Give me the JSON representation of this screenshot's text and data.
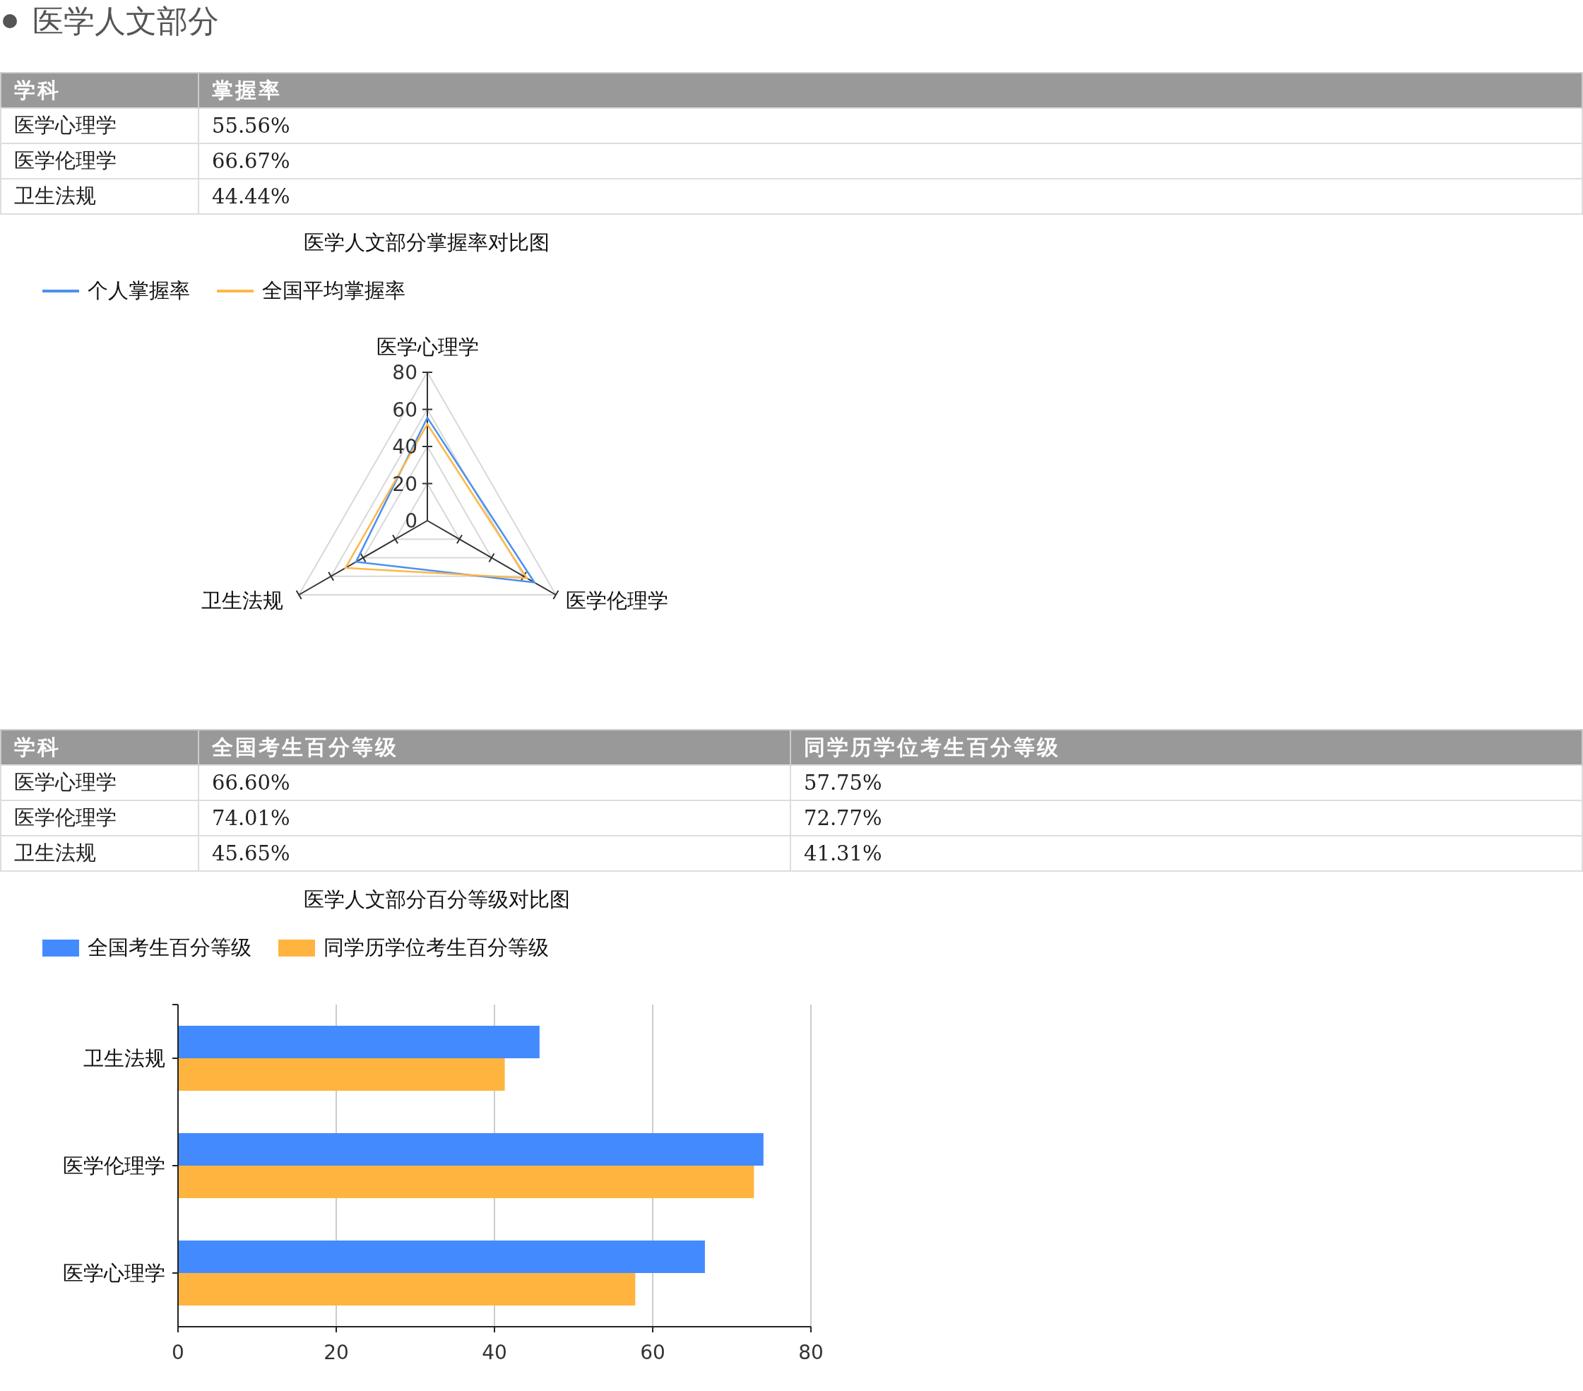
{
  "heading": "医学人文部分",
  "mastery_table": {
    "columns": [
      "学科",
      "掌握率"
    ],
    "rows": [
      [
        "医学心理学",
        "55.56%"
      ],
      [
        "医学伦理学",
        "66.67%"
      ],
      [
        "卫生法规",
        "44.44%"
      ]
    ]
  },
  "radar_chart": {
    "chart_data": {
      "type": "radar",
      "title": "医学人文部分掌握率对比图",
      "categories": [
        "医学心理学",
        "医学伦理学",
        "卫生法规"
      ],
      "series": [
        {
          "name": "个人掌握率",
          "color": "#4a90f0",
          "values": [
            55.56,
            66.67,
            44.44
          ]
        },
        {
          "name": "全国平均掌握率",
          "color": "#ffb648",
          "values": [
            52,
            62,
            51
          ]
        }
      ],
      "ylim": [
        0,
        80
      ],
      "yticks": [
        0,
        20,
        40,
        60,
        80
      ],
      "legend": "top-left"
    }
  },
  "percentile_table": {
    "columns": [
      "学科",
      "全国考生百分等级",
      "同学历学位考生百分等级"
    ],
    "rows": [
      [
        "医学心理学",
        "66.60%",
        "57.75%"
      ],
      [
        "医学伦理学",
        "74.01%",
        "72.77%"
      ],
      [
        "卫生法规",
        "45.65%",
        "41.31%"
      ]
    ]
  },
  "bar_chart": {
    "chart_data": {
      "type": "bar",
      "orientation": "horizontal",
      "title": "医学人文部分百分等级对比图",
      "categories": [
        "卫生法规",
        "医学伦理学",
        "医学心理学"
      ],
      "series": [
        {
          "name": "全国考生百分等级",
          "color": "#448aff",
          "values": [
            45.7,
            74,
            66.6
          ]
        },
        {
          "name": "同学历学位考生百分等级",
          "color": "#ffb43f",
          "values": [
            41.3,
            72.8,
            57.8
          ]
        }
      ],
      "xlim": [
        0,
        80
      ],
      "xticks": [
        0,
        20,
        40,
        60,
        80
      ],
      "grid": true,
      "legend": "top-left"
    }
  }
}
